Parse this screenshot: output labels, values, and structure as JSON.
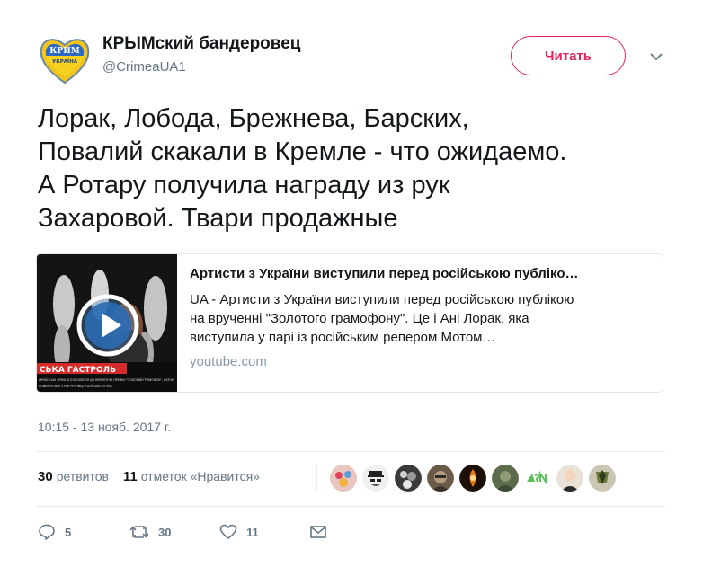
{
  "author": {
    "display_name": "КРЫМский бандеровец",
    "handle": "@CrimeaUA1",
    "avatar_text_top": "КРИМ",
    "avatar_text_bottom": "УКРАЇНА"
  },
  "follow_button": {
    "label": "Читать"
  },
  "tweet": {
    "lines": [
      "Лорак, Лобода, Брежнева, Барских,",
      "Повалий скакали в Кремле - что ожидаемо.",
      "А Ротару получила награду из рук",
      "Захаровой. Твари продажные"
    ],
    "timestamp": "10:15 - 13 нояб. 2017 г."
  },
  "card": {
    "title": "Артисти з України виступили перед російською публіко…",
    "description_lines": [
      "UA - Артисти з України виступили перед російською публікою",
      "на врученні \"Золотого грамофону\". Це і Ані Лорак, яка",
      "виступила у парі із російським репером Мотом…"
    ],
    "domain": "youtube.com",
    "thumb_banner": "СЬКА ГАСТРОЛЬ",
    "thumb_caption_1": "УКРАЇНСЬКІ ЗІРКИ ЗГОЛОСИЛИСЯ ДО КРЕМЛЯ НА ПРЕМІЮ \"ЗОЛОТИЙ ГРАМОФОН\", НАТОМ",
    "thumb_caption_2": "СОФІЯ РОТАРУ З РУК РЕЧНИЦІ РОСІЙСЬКОГО МЗС"
  },
  "stats": {
    "retweets_count": "30",
    "retweets_label": "ретвитов",
    "likes_count": "11",
    "likes_label": "отметок «Нравится»"
  },
  "actions": {
    "reply_count": "5",
    "retweet_count": "30",
    "like_count": "11"
  },
  "colors": {
    "accent": "#e0245e",
    "secondary_text": "#657786",
    "border": "#e6ecf0"
  }
}
